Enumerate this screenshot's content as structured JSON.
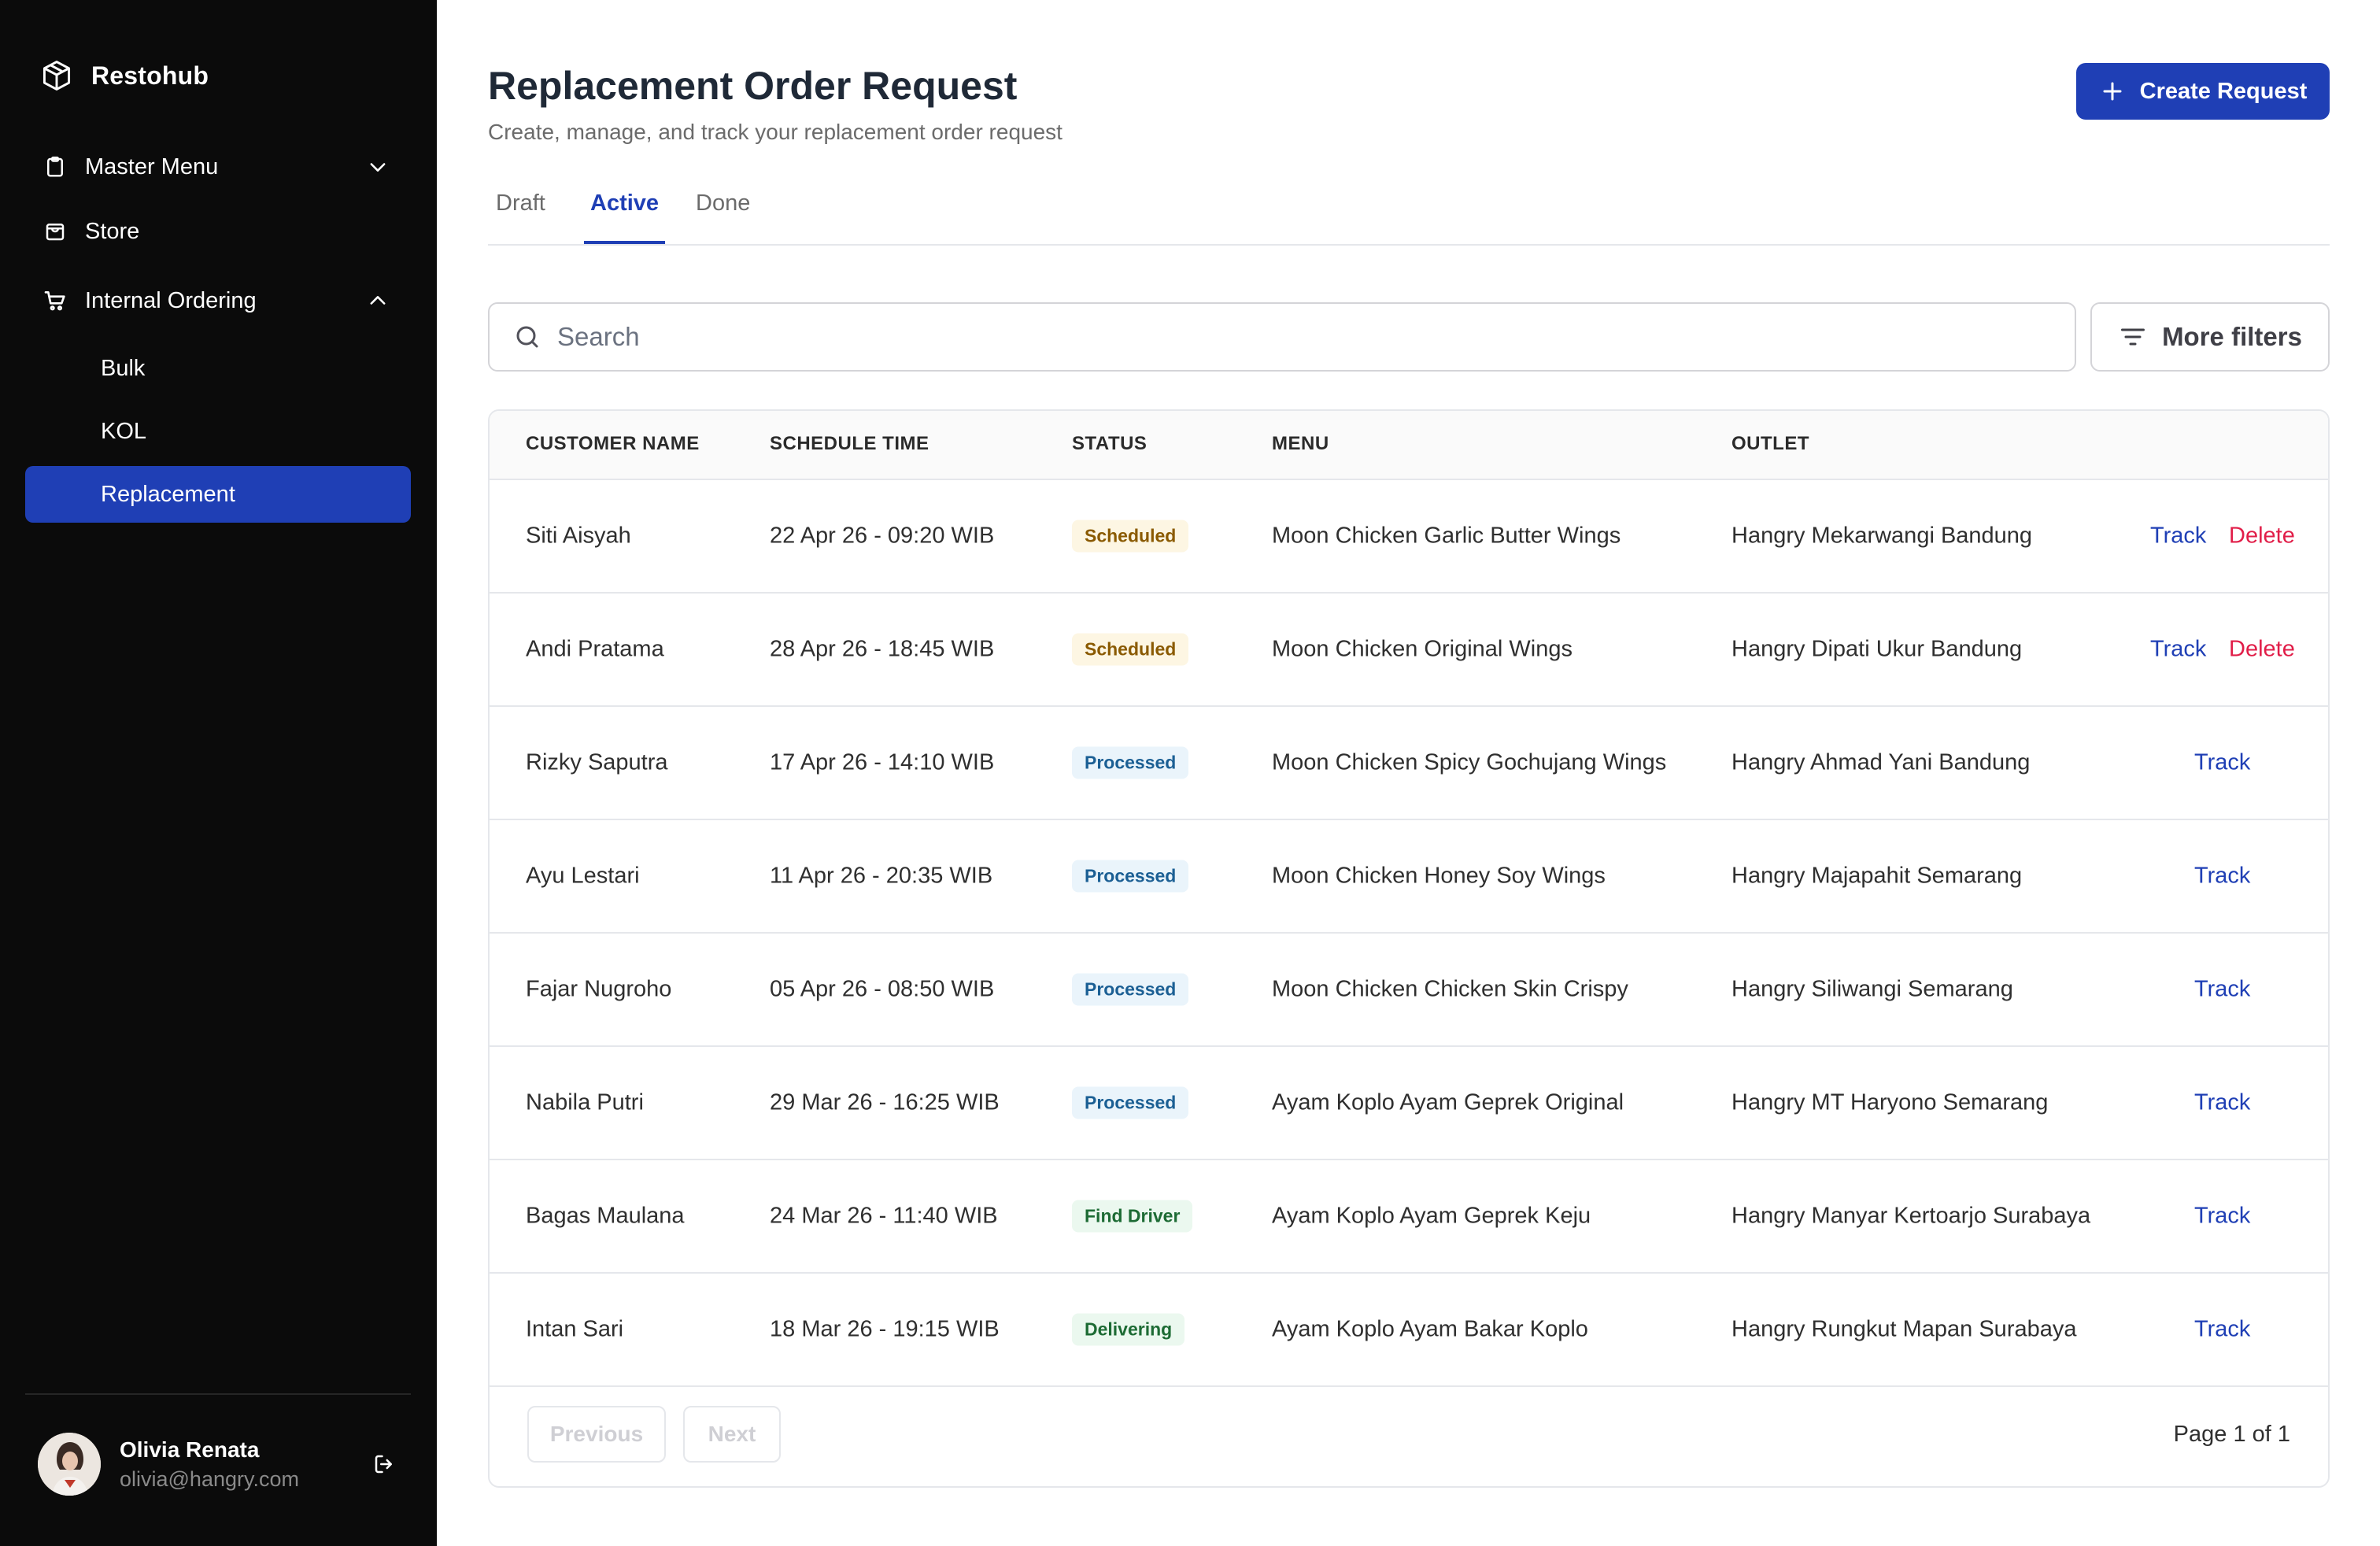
{
  "app": {
    "name": "Restohub"
  },
  "sidebar": {
    "items": [
      {
        "label": "Master Menu",
        "icon": "clipboard-icon"
      },
      {
        "label": "Store",
        "icon": "store-icon"
      },
      {
        "label": "Internal Ordering",
        "icon": "cart-icon"
      }
    ],
    "sub_items": [
      "Bulk",
      "KOL",
      "Replacement"
    ],
    "active_sub": "Replacement"
  },
  "user": {
    "name": "Olivia Renata",
    "email": "olivia@hangry.com"
  },
  "header": {
    "title": "Replacement Order Request",
    "subtitle": "Create, manage, and track your replacement order request",
    "create_label": "Create Request"
  },
  "tabs": [
    {
      "label": "Draft",
      "active": false
    },
    {
      "label": "Active",
      "active": true
    },
    {
      "label": "Done",
      "active": false
    }
  ],
  "search": {
    "placeholder": "Search"
  },
  "filters_label": "More filters",
  "table": {
    "columns": [
      "CUSTOMER NAME",
      "SCHEDULE TIME",
      "STATUS",
      "MENU",
      "OUTLET"
    ],
    "rows": [
      {
        "customer": "Siti Aisyah",
        "time": "22 Apr 26 - 09:20 WIB",
        "status": "Scheduled",
        "menu": "Moon Chicken Garlic Butter Wings",
        "outlet": "Hangry Mekarwangi Bandung",
        "track": "Track",
        "delete": "Delete"
      },
      {
        "customer": "Andi Pratama",
        "time": "28 Apr 26 - 18:45 WIB",
        "status": "Scheduled",
        "menu": "Moon Chicken Original Wings",
        "outlet": "Hangry Dipati Ukur Bandung",
        "track": "Track",
        "delete": "Delete"
      },
      {
        "customer": "Rizky Saputra",
        "time": "17 Apr 26 - 14:10 WIB",
        "status": "Processed",
        "menu": "Moon Chicken Spicy Gochujang Wings",
        "outlet": "Hangry Ahmad Yani Bandung",
        "track": "Track"
      },
      {
        "customer": "Ayu Lestari",
        "time": "11 Apr 26 - 20:35 WIB",
        "status": "Processed",
        "menu": "Moon Chicken Honey Soy Wings",
        "outlet": "Hangry Majapahit Semarang",
        "track": "Track"
      },
      {
        "customer": "Fajar Nugroho",
        "time": "05 Apr 26 - 08:50 WIB",
        "status": "Processed",
        "menu": "Moon Chicken Chicken Skin Crispy",
        "outlet": "Hangry Siliwangi Semarang",
        "track": "Track"
      },
      {
        "customer": "Nabila Putri",
        "time": "29 Mar 26 - 16:25 WIB",
        "status": "Processed",
        "menu": "Ayam Koplo Ayam Geprek Original",
        "outlet": "Hangry MT Haryono Semarang",
        "track": "Track"
      },
      {
        "customer": "Bagas Maulana",
        "time": "24 Mar 26 - 11:40 WIB",
        "status": "Find Driver",
        "menu": "Ayam Koplo Ayam Geprek Keju",
        "outlet": "Hangry Manyar Kertoarjo Surabaya",
        "track": "Track"
      },
      {
        "customer": "Intan Sari",
        "time": "18 Mar 26 - 19:15 WIB",
        "status": "Delivering",
        "menu": "Ayam Koplo Ayam Bakar Koplo",
        "outlet": "Hangry Rungkut Mapan Surabaya",
        "track": "Track"
      }
    ]
  },
  "pagination": {
    "previous": "Previous",
    "next": "Next",
    "page_info": "Page 1 of 1"
  },
  "colors": {
    "primary": "#1f3fb5",
    "sidebar_bg": "#0b0b0b",
    "danger": "#e11d48"
  }
}
